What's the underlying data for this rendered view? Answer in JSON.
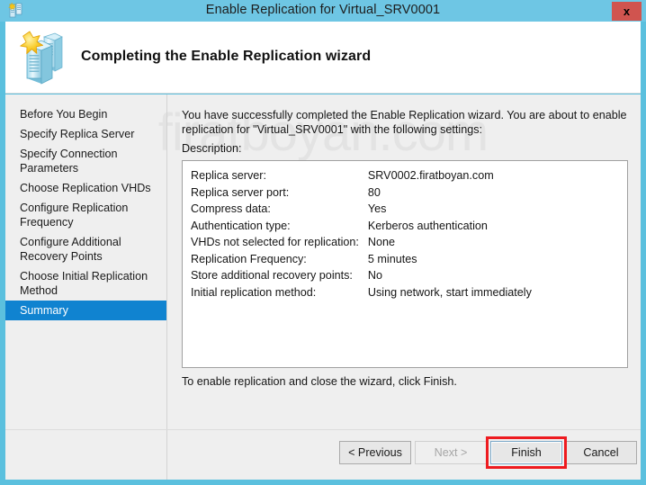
{
  "window": {
    "title": "Enable Replication for Virtual_SRV0001",
    "close_label": "x",
    "titlebar_color": "#6ec6e4",
    "frame_color": "#5bc0de",
    "close_button_color": "#d0544f"
  },
  "header": {
    "title": "Completing the Enable Replication wizard",
    "icon": "servers-with-star-icon"
  },
  "watermark": {
    "text": "firatboyan.com"
  },
  "sidebar": {
    "selected_index": 7,
    "highlight_color": "#1083d0",
    "items": [
      {
        "label": "Before You Begin"
      },
      {
        "label": "Specify Replica Server"
      },
      {
        "label": "Specify Connection Parameters"
      },
      {
        "label": "Choose Replication VHDs"
      },
      {
        "label": "Configure Replication Frequency"
      },
      {
        "label": "Configure Additional Recovery Points"
      },
      {
        "label": "Choose Initial Replication Method"
      },
      {
        "label": "Summary"
      }
    ]
  },
  "content": {
    "intro": "You have successfully completed the Enable Replication wizard. You are about to enable replication for \"Virtual_SRV0001\" with the following settings:",
    "description_label": "Description:",
    "details": [
      {
        "key": "Replica server:",
        "value": "SRV0002.firatboyan.com"
      },
      {
        "key": "Replica server port:",
        "value": "80"
      },
      {
        "key": "Compress data:",
        "value": "Yes"
      },
      {
        "key": "Authentication type:",
        "value": "Kerberos authentication"
      },
      {
        "key": "VHDs not selected for replication:",
        "value": "None"
      },
      {
        "key": "Replication Frequency:",
        "value": "5 minutes"
      },
      {
        "key": "Store additional recovery points:",
        "value": "No"
      },
      {
        "key": "Initial replication method:",
        "value": "Using network, start immediately"
      }
    ],
    "footnote": "To enable replication and close the wizard, click Finish."
  },
  "buttons": {
    "previous": "< Previous",
    "next": "Next >",
    "finish": "Finish",
    "cancel": "Cancel",
    "next_disabled": true,
    "finish_highlight_color": "#ee1b20"
  }
}
